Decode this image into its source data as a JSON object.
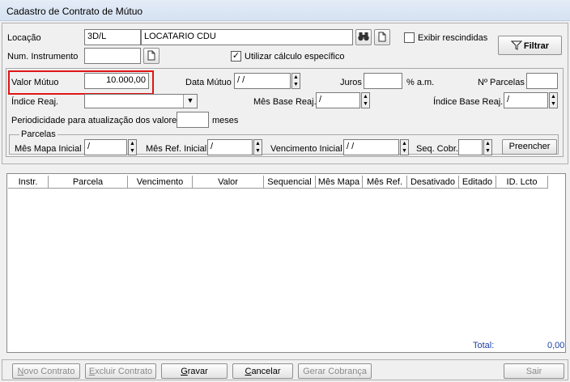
{
  "window": {
    "title": "Cadastro de Contrato de Mútuo"
  },
  "filters": {
    "locacao_label": "Locação",
    "locacao_code": "3D/L",
    "locacao_name": "LOCATARIO CDU",
    "num_instrumento_label": "Num. Instrumento",
    "num_instrumento_value": "",
    "exibir_rescindidas_label": "Exibir rescindidas",
    "exibir_rescindidas_checked": false,
    "utilizar_calculo_label": "Utilizar cálculo específico",
    "utilizar_calculo_checked": true,
    "filtrar_label": "Filtrar"
  },
  "mutuo": {
    "valor_label": "Valor Mútuo",
    "valor_value": "10.000,00",
    "data_label": "Data Mútuo",
    "data_value": "/ /",
    "juros_label": "Juros",
    "juros_value": "",
    "juros_unit": "% a.m.",
    "parcelas_label": "Nº Parcelas",
    "parcelas_value": "",
    "indice_label": "Índice Reaj.",
    "indice_value": "",
    "mes_base_label": "Mês Base Reaj.",
    "mes_base_value": "/",
    "indice_base_label": "Índice Base Reaj.",
    "indice_base_value": "/",
    "periodicidade_label": "Periodicidade para atualização dos valores",
    "periodicidade_value": "",
    "periodicidade_unit": "meses"
  },
  "parcelas": {
    "group_label": "Parcelas",
    "mes_mapa_label": "Mês Mapa Inicial",
    "mes_mapa_value": "/",
    "mes_ref_label": "Mês Ref. Inicial",
    "mes_ref_value": "/",
    "vencimento_label": "Vencimento Inicial",
    "vencimento_value": "/ /",
    "seq_cobr_label": "Seq. Cobr.",
    "seq_cobr_value": "",
    "preencher_label": "Preencher"
  },
  "grid": {
    "columns": [
      "Instr.",
      "Parcela",
      "Vencimento",
      "Valor",
      "Sequencial",
      "Mês Mapa",
      "Mês Ref.",
      "Desativado",
      "Editado",
      "ID. Lcto"
    ],
    "total_label": "Total:",
    "total_value": "0,00"
  },
  "actions": {
    "novo_hot": "N",
    "novo_rest": "ovo Contrato",
    "excluir_hot": "E",
    "excluir_rest": "xcluir Contrato",
    "gravar_hot": "G",
    "gravar_rest": "ravar",
    "cancelar_hot": "C",
    "cancelar_rest": "ancelar",
    "gerar_label": "Gerar Cobrança",
    "sair_label": "Sair"
  }
}
